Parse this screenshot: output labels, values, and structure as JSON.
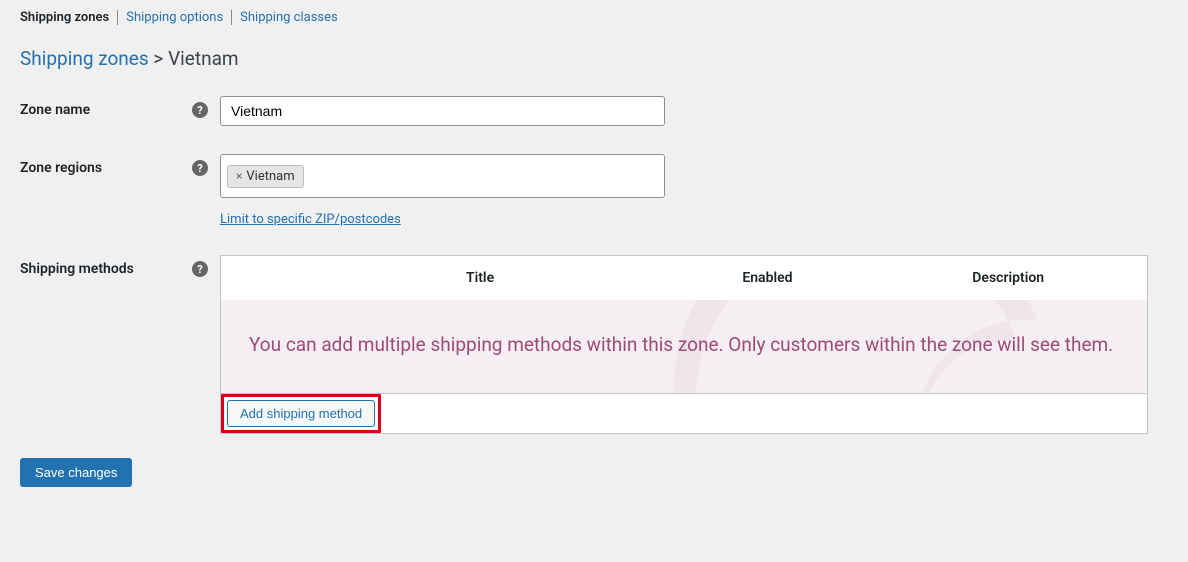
{
  "tabs": {
    "zones": "Shipping zones",
    "options": "Shipping options",
    "classes": "Shipping classes"
  },
  "breadcrumb": {
    "root": "Shipping zones",
    "sep": ">",
    "current": "Vietnam"
  },
  "form": {
    "zone_name_label": "Zone name",
    "zone_name_value": "Vietnam",
    "zone_regions_label": "Zone regions",
    "region_tag": "Vietnam",
    "zip_link": "Limit to specific ZIP/postcodes",
    "shipping_methods_label": "Shipping methods"
  },
  "methods_table": {
    "th_title": "Title",
    "th_enabled": "Enabled",
    "th_description": "Description",
    "empty_message": "You can add multiple shipping methods within this zone. Only customers within the zone will see them.",
    "add_button": "Add shipping method"
  },
  "save_button": "Save changes",
  "help_glyph": "?"
}
